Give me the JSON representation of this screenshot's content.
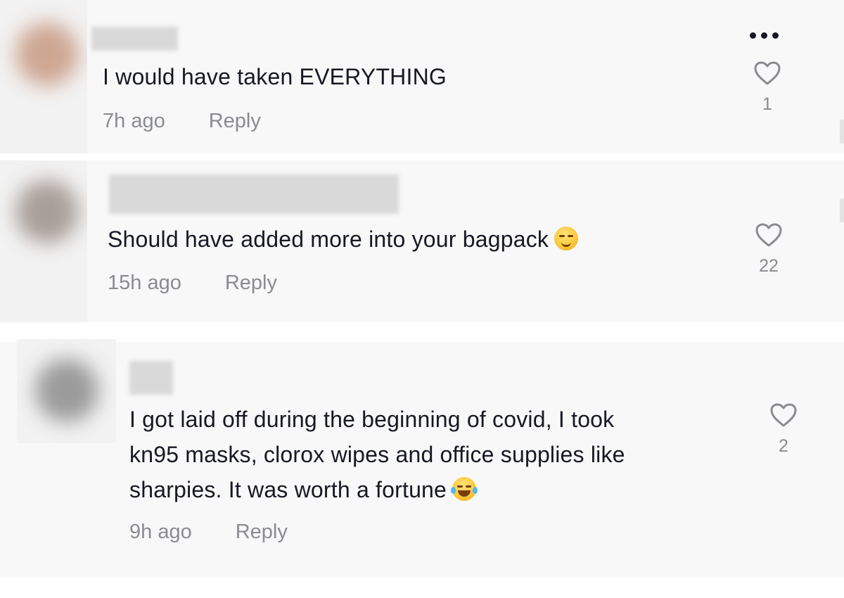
{
  "comments": [
    {
      "text": "I would have taken EVERYTHING",
      "time": "7h ago",
      "reply_label": "Reply",
      "likes": "1",
      "emoji": ""
    },
    {
      "text": "Should have added more into your bagpack",
      "time": "15h ago",
      "reply_label": "Reply",
      "likes": "22",
      "emoji": "smirk-face"
    },
    {
      "text_lines": [
        "I got laid off during the beginning of covid, I took",
        "kn95 masks, clorox wipes and office supplies like",
        "sharpies. It was worth a fortune"
      ],
      "time": "9h ago",
      "reply_label": "Reply",
      "likes": "2",
      "emoji": "tears-of-joy-face"
    }
  ],
  "colors": {
    "card_bg": "#f8f8f8",
    "text_primary": "#161823",
    "text_secondary": "#8a8b91"
  },
  "icons": {
    "more": "more-horizontal-icon",
    "like": "heart-outline-icon"
  }
}
